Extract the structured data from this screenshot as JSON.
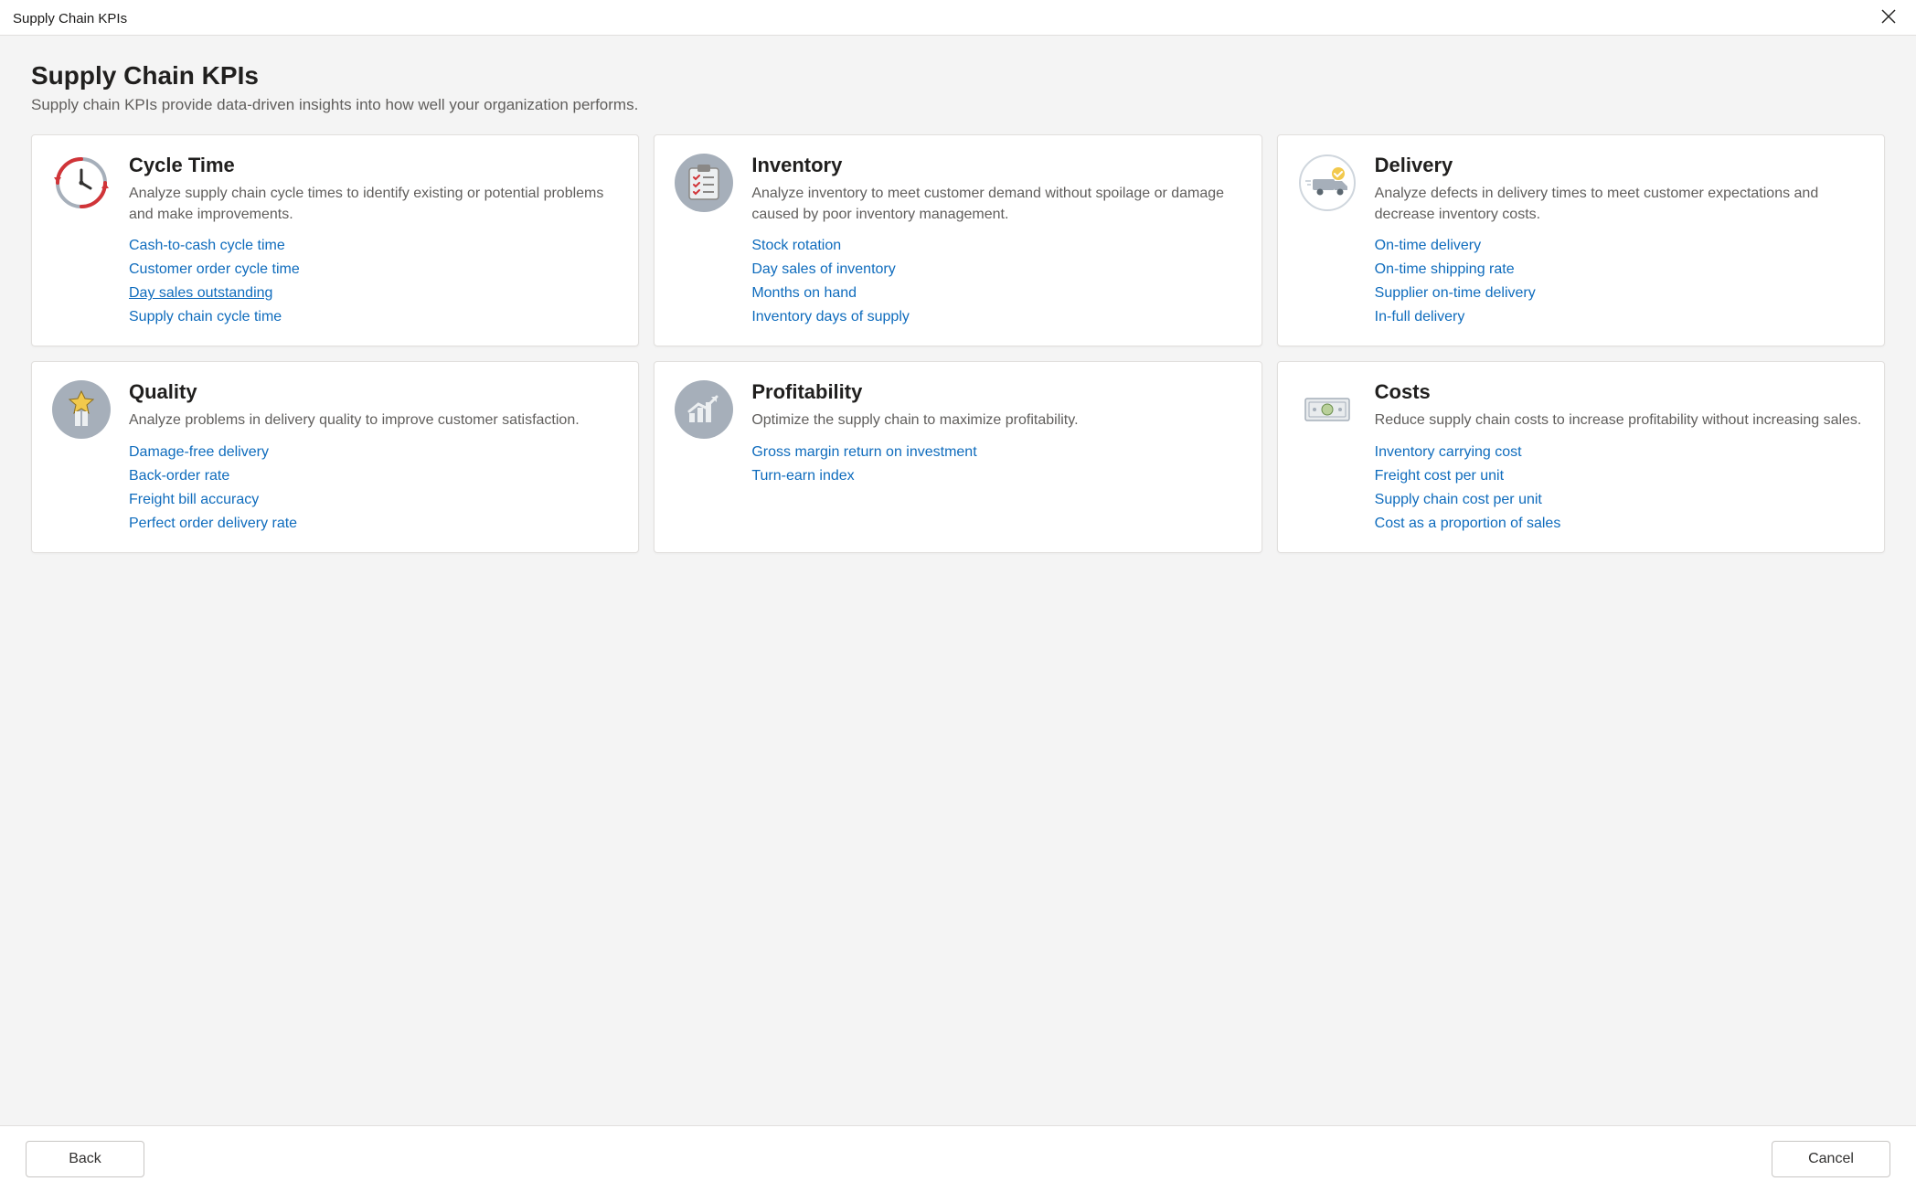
{
  "window": {
    "title": "Supply Chain KPIs"
  },
  "page": {
    "title": "Supply Chain KPIs",
    "subtitle": "Supply chain KPIs provide data-driven insights into how well your organization performs."
  },
  "cards": {
    "cycle_time": {
      "title": "Cycle Time",
      "desc": "Analyze supply chain cycle times to identify existing or potential problems and make improvements.",
      "links": [
        "Cash-to-cash cycle time",
        "Customer order cycle time",
        "Day sales outstanding",
        "Supply chain cycle time"
      ]
    },
    "inventory": {
      "title": "Inventory",
      "desc": "Analyze inventory to meet customer demand without spoilage or damage caused by poor inventory management.",
      "links": [
        "Stock rotation",
        "Day sales of inventory",
        "Months on hand",
        "Inventory days of supply"
      ]
    },
    "delivery": {
      "title": "Delivery",
      "desc": "Analyze defects in delivery times to meet customer expectations and decrease inventory costs.",
      "links": [
        "On-time delivery",
        "On-time shipping rate",
        "Supplier on-time delivery",
        "In-full delivery"
      ]
    },
    "quality": {
      "title": "Quality",
      "desc": "Analyze problems in delivery quality to improve customer satisfaction.",
      "links": [
        "Damage-free delivery",
        "Back-order rate",
        "Freight bill accuracy",
        "Perfect order delivery rate"
      ]
    },
    "profitability": {
      "title": "Profitability",
      "desc": "Optimize the supply chain to maximize profitability.",
      "links": [
        "Gross margin return on investment",
        "Turn-earn index"
      ]
    },
    "costs": {
      "title": "Costs",
      "desc": "Reduce supply chain costs to increase profitability without increasing sales.",
      "links": [
        "Inventory carrying cost",
        "Freight cost per unit",
        "Supply chain cost per unit",
        "Cost as a proportion of sales"
      ]
    }
  },
  "footer": {
    "back": "Back",
    "cancel": "Cancel"
  }
}
